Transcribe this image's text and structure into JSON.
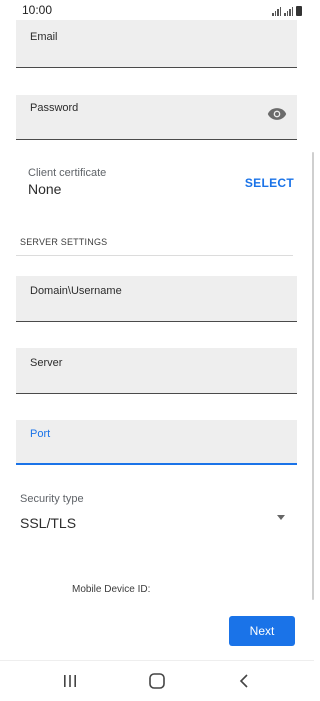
{
  "status_bar": {
    "time": "10:00"
  },
  "form": {
    "email": {
      "label": "Email",
      "value": ""
    },
    "password": {
      "label": "Password",
      "value": "",
      "toggle_icon": "eye-icon"
    },
    "client_certificate": {
      "label": "Client certificate",
      "value": "None",
      "action": "SELECT"
    },
    "server_settings": {
      "header": "SERVER SETTINGS",
      "domain_username": {
        "label": "Domain\\Username",
        "value": ""
      },
      "server": {
        "label": "Server",
        "value": ""
      },
      "port": {
        "label": "Port",
        "value": "",
        "focused": true
      },
      "security_type": {
        "label": "Security type",
        "value": "SSL/TLS"
      }
    },
    "mobile_device_id": {
      "label": "Mobile Device ID:"
    },
    "next_label": "Next"
  },
  "nav_bar": {
    "items": [
      "recent-apps-icon",
      "home-icon",
      "back-icon"
    ]
  },
  "colors": {
    "accent": "#1a73e8",
    "field_bg": "#eeeeee"
  }
}
